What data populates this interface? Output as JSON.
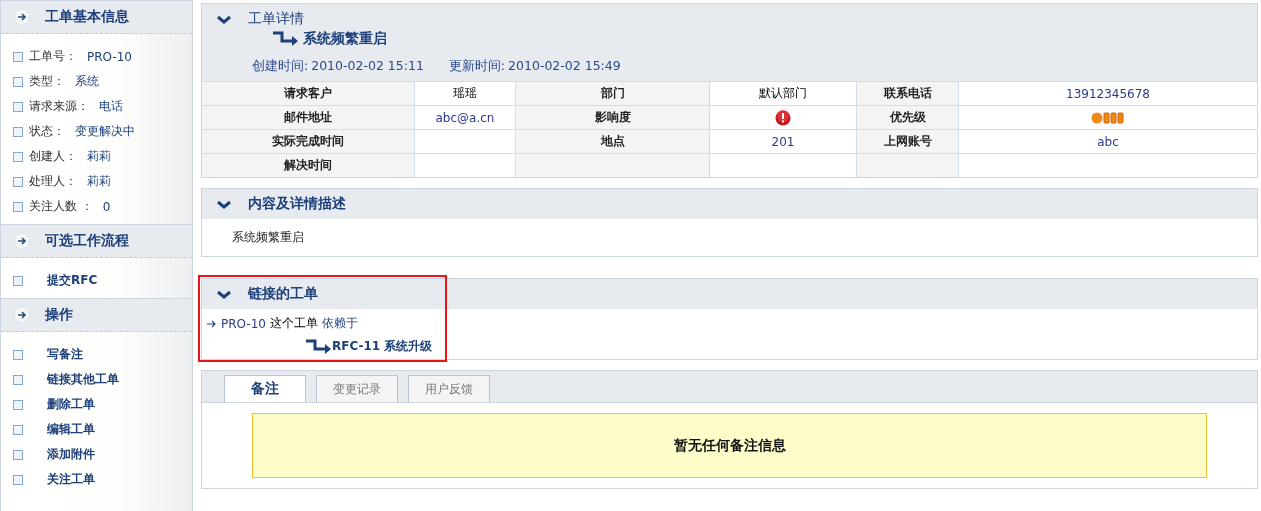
{
  "sidebar": {
    "sections": [
      {
        "title": "工单基本信息",
        "kind": "info",
        "items": [
          {
            "label": "工单号：",
            "value": "PRO-10"
          },
          {
            "label": "类型：",
            "value": "系统"
          },
          {
            "label": "请求来源：",
            "value": "电话"
          },
          {
            "label": "状态：",
            "value": "变更解决中"
          },
          {
            "label": "创建人：",
            "value": "莉莉"
          },
          {
            "label": "处理人：",
            "value": "莉莉"
          },
          {
            "label": "关注人数 ：",
            "value": "0"
          }
        ]
      },
      {
        "title": "可选工作流程",
        "kind": "actions",
        "items": [
          {
            "label": "提交RFC"
          }
        ]
      },
      {
        "title": "操作",
        "kind": "actions",
        "items": [
          {
            "label": "写备注"
          },
          {
            "label": "链接其他工单"
          },
          {
            "label": "删除工单"
          },
          {
            "label": "编辑工单"
          },
          {
            "label": "添加附件"
          },
          {
            "label": "关注工单"
          }
        ]
      }
    ]
  },
  "details": {
    "title": "工单详情",
    "subject": "系统频繁重启",
    "created_label": "创建时间:",
    "created": "2010-02-02 15:11",
    "updated_label": "更新时间:",
    "updated": "2010-02-02 15:49",
    "rows": [
      [
        {
          "kind": "label",
          "text": "请求客户"
        },
        {
          "kind": "value",
          "text": "瑶瑶"
        },
        {
          "kind": "label",
          "text": "部门"
        },
        {
          "kind": "value",
          "text": "默认部门"
        },
        {
          "kind": "label",
          "text": "联系电话"
        },
        {
          "kind": "number",
          "text": "13912345678"
        }
      ],
      [
        {
          "kind": "label",
          "text": "邮件地址"
        },
        {
          "kind": "number",
          "text": "abc@a.cn"
        },
        {
          "kind": "label",
          "text": "影响度"
        },
        {
          "kind": "impact"
        },
        {
          "kind": "label",
          "text": "优先级"
        },
        {
          "kind": "priority"
        }
      ],
      [
        {
          "kind": "label",
          "text": "实际完成时间"
        },
        {
          "kind": "value"
        },
        {
          "kind": "label",
          "text": "地点"
        },
        {
          "kind": "number",
          "text": "201"
        },
        {
          "kind": "label",
          "text": "上网账号"
        },
        {
          "kind": "number",
          "text": "abc"
        }
      ],
      [
        {
          "kind": "label",
          "text": "解决时间"
        },
        {
          "kind": "value"
        },
        {
          "kind": "label"
        },
        {
          "kind": "value"
        },
        {
          "kind": "label"
        },
        {
          "kind": "value"
        }
      ]
    ]
  },
  "description": {
    "title": "内容及详情描述",
    "text": "系统频繁重启"
  },
  "linked": {
    "title": "链接的工单",
    "highlighted": true,
    "source": "PRO-10",
    "phrase": "这个工单",
    "relation": "依赖于",
    "target": "RFC-11 系统升级"
  },
  "notes": {
    "tabs": [
      {
        "label": "备注",
        "selected": true
      },
      {
        "label": "变更记录",
        "selected": false
      },
      {
        "label": "用户反馈",
        "selected": false
      }
    ],
    "message": "暂无任何备注信息"
  }
}
